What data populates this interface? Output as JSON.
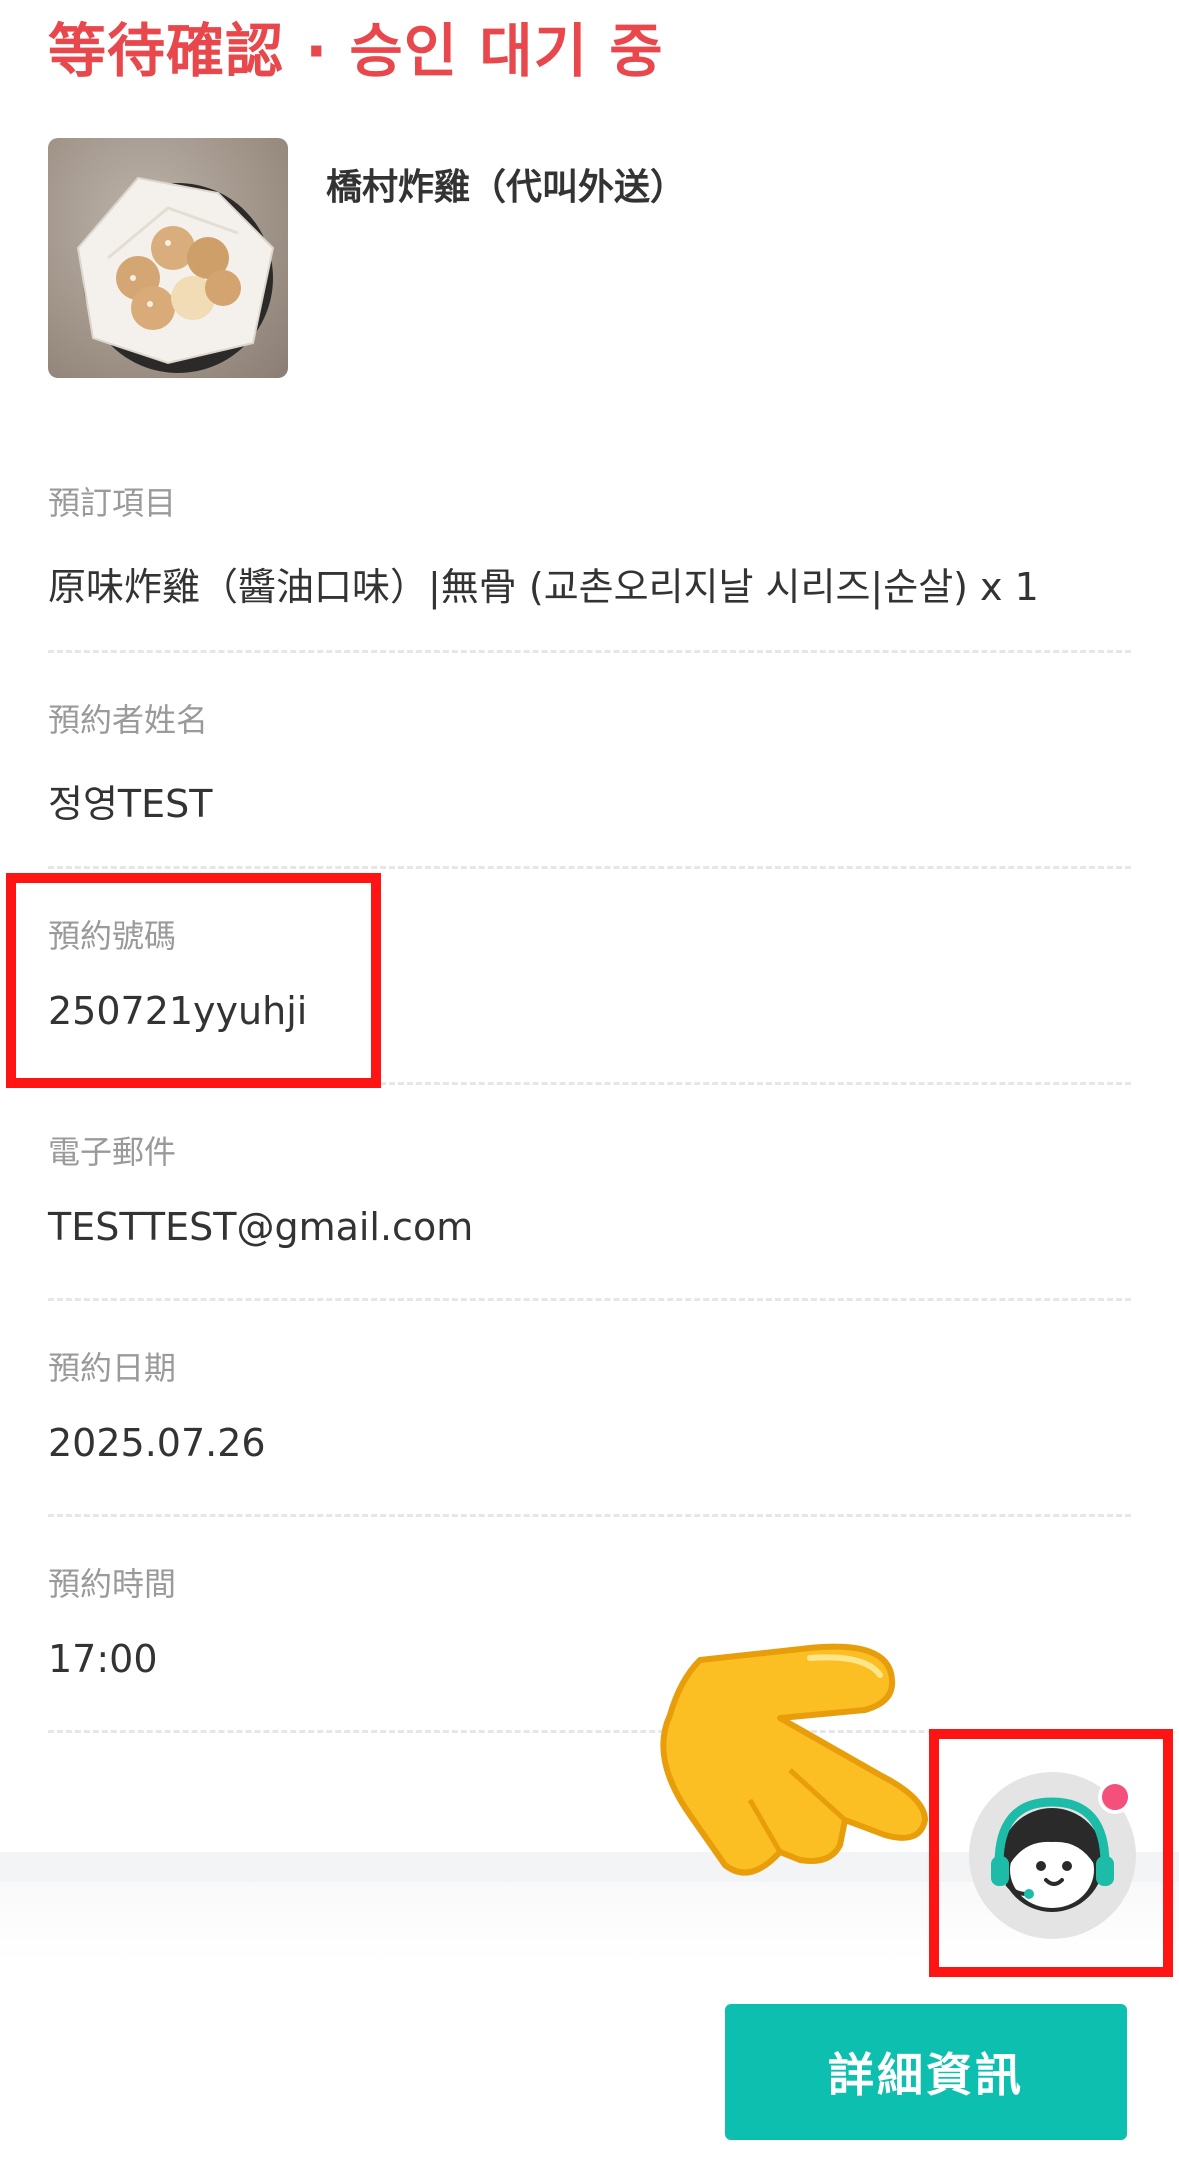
{
  "header": {
    "status_title": "等待確認 · 승인 대기 중"
  },
  "product": {
    "name": "橋村炸雞（代叫外送）",
    "thumbnail_icon": "fried-chicken-photo"
  },
  "fields": [
    {
      "label": "預訂項目",
      "value": "原味炸雞（醬油口味）|無骨 (교촌오리지날 시리즈|순살) x 1"
    },
    {
      "label": "預約者姓名",
      "value": "정영TEST"
    },
    {
      "label": "預約號碼",
      "value": "250721yyuhji"
    },
    {
      "label": "電子郵件",
      "value": "TESTTEST@gmail.com"
    },
    {
      "label": "預約日期",
      "value": "2025.07.26"
    },
    {
      "label": "預約時間",
      "value": "17:00"
    }
  ],
  "actions": {
    "detail_button_label": "詳細資訊",
    "cs_button_icon": "customer-service-agent-icon",
    "pointer_icon": "pointing-hand-icon"
  },
  "colors": {
    "status_red": "#e8474b",
    "primary_teal": "#0dbfae",
    "highlight_red": "#ff1414",
    "notification_pink": "#f54f7b",
    "pointer_yellow": "#fbbf24"
  }
}
